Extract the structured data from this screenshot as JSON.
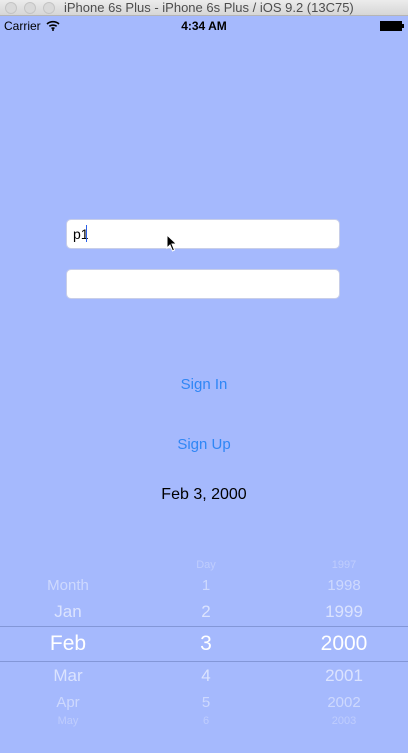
{
  "window": {
    "title": "iPhone 6s Plus - iPhone 6s Plus / iOS 9.2 (13C75)"
  },
  "status_bar": {
    "carrier": "Carrier",
    "time": "4:34 AM"
  },
  "login": {
    "username_value": "p1",
    "password_value": "",
    "sign_in_label": "Sign In",
    "sign_up_label": "Sign Up"
  },
  "date_label": "Feb 3, 2000",
  "picker": {
    "months": [
      "Month",
      "Jan",
      "Feb",
      "Mar",
      "Apr",
      "May"
    ],
    "days": [
      "Day",
      "1",
      "2",
      "3",
      "4",
      "5",
      "6"
    ],
    "years": [
      "1997",
      "1998",
      "1999",
      "2000",
      "2001",
      "2002",
      "2003"
    ],
    "selected": {
      "month": "Feb",
      "day": "3",
      "year": "2000"
    }
  },
  "colors": {
    "background": "#a5b9fd",
    "link": "#2f86f5",
    "text": "#000000"
  }
}
